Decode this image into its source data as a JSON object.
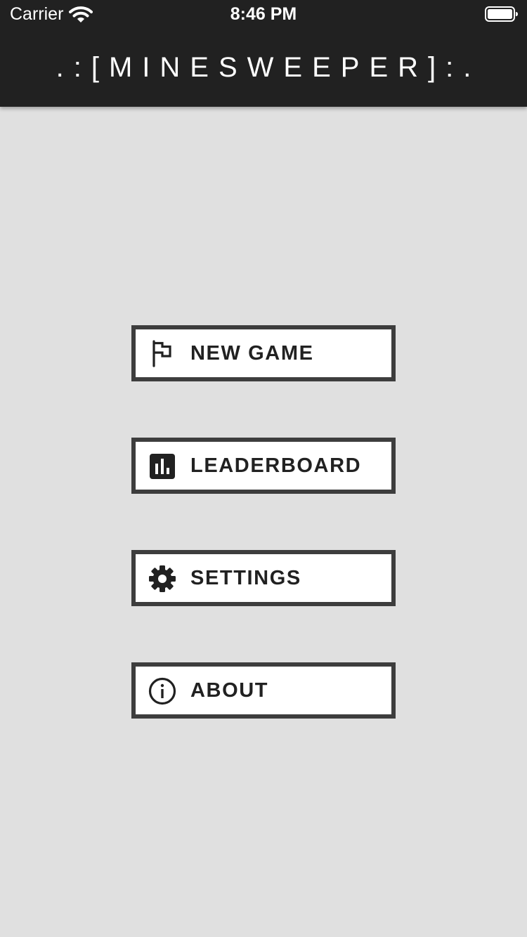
{
  "status_bar": {
    "carrier": "Carrier",
    "time": "8:46 PM",
    "wifi_icon": "wifi-icon",
    "battery_icon": "battery-full-icon"
  },
  "header": {
    "title": ".:[MINESWEEPER]:."
  },
  "menu": {
    "items": [
      {
        "label": "NEW GAME",
        "icon": "flag-icon"
      },
      {
        "label": "LEADERBOARD",
        "icon": "leaderboard-icon"
      },
      {
        "label": "SETTINGS",
        "icon": "gear-icon"
      },
      {
        "label": "ABOUT",
        "icon": "info-icon"
      }
    ]
  },
  "colors": {
    "background": "#e0e0e0",
    "header": "#212121",
    "button_border": "#3d3d3d",
    "button_fill": "#ffffff",
    "text_dark": "#212121"
  }
}
